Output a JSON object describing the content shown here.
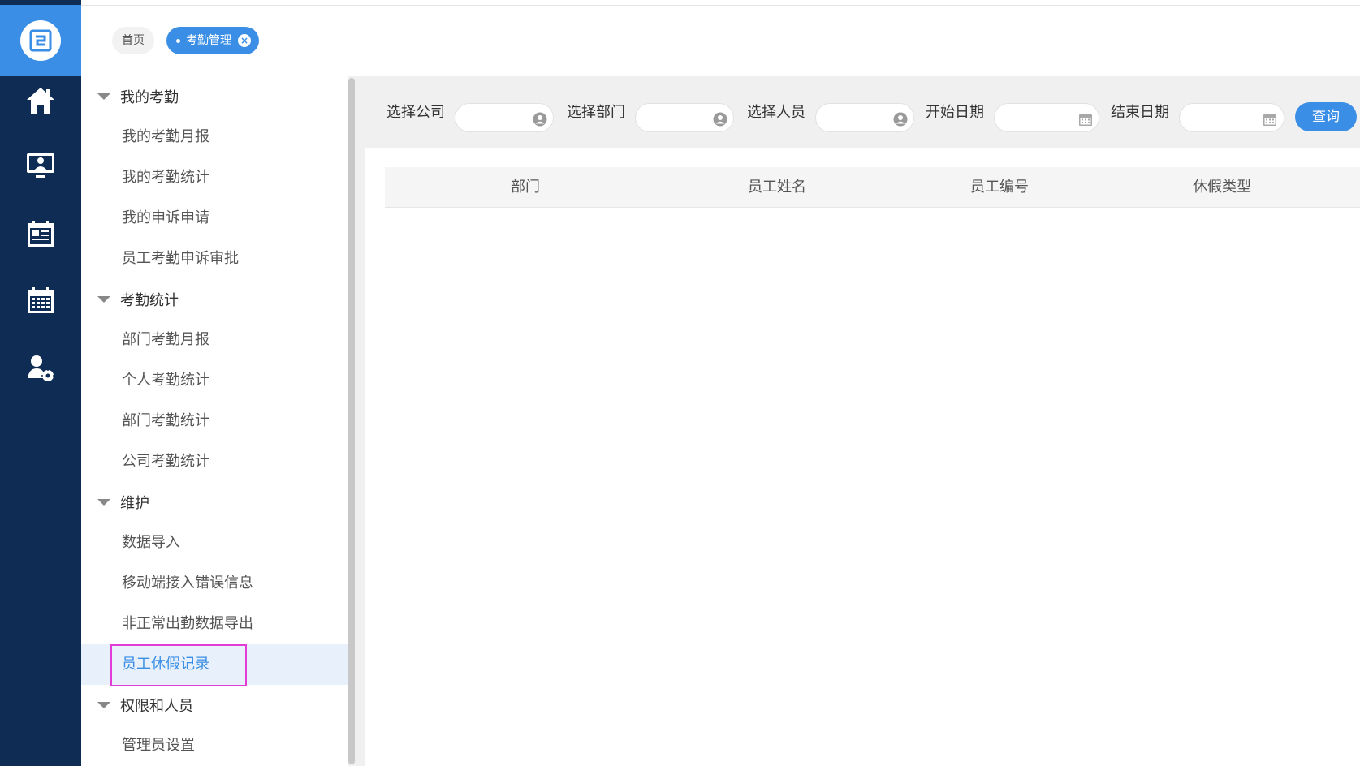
{
  "rail": {
    "logo_icon": "app-logo-icon",
    "icons": [
      "home-icon",
      "monitor-user-icon",
      "calendar-list-icon",
      "calendar-grid-icon",
      "user-gear-icon"
    ]
  },
  "tabs": {
    "home": "首页",
    "active": "考勤管理",
    "close_icon": "close-circle-icon"
  },
  "menu": {
    "groups": [
      {
        "label": "我的考勤",
        "items": [
          "我的考勤月报",
          "我的考勤统计",
          "我的申诉申请",
          "员工考勤申诉审批"
        ]
      },
      {
        "label": "考勤统计",
        "items": [
          "部门考勤月报",
          "个人考勤统计",
          "部门考勤统计",
          "公司考勤统计"
        ]
      },
      {
        "label": "维护",
        "items": [
          "数据导入",
          "移动端接入错误信息",
          "非正常出勤数据导出",
          "员工休假记录"
        ]
      },
      {
        "label": "权限和人员",
        "items": [
          "管理员设置"
        ]
      }
    ],
    "active_item": "员工休假记录"
  },
  "filters": {
    "company_label": "选择公司",
    "department_label": "选择部门",
    "person_label": "选择人员",
    "start_date_label": "开始日期",
    "end_date_label": "结束日期",
    "company_value": "",
    "department_value": "",
    "person_value": "",
    "start_date_value": "",
    "end_date_value": "",
    "query_button": "查询"
  },
  "table": {
    "columns": [
      "部门",
      "员工姓名",
      "员工编号",
      "休假类型"
    ]
  },
  "colors": {
    "rail_bg": "#0f2c55",
    "accent": "#3a8ee6",
    "highlight_border": "#e23bd8"
  }
}
